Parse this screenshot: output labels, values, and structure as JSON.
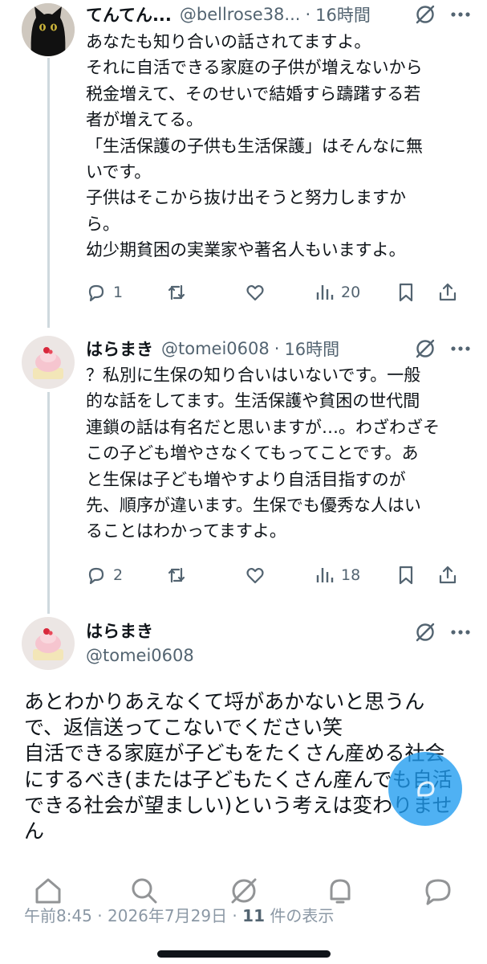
{
  "tweets": [
    {
      "display_name": "てんてん...",
      "handle": "@bellrose38...",
      "separator": "·",
      "time": "16時間",
      "text_lines": [
        "あなたも知り合いの話されてますよ。",
        "それに自活できる家庭の子供が増えないから",
        "税金増えて、そのせいで結婚すら躊躇する若",
        "者が増えてる。",
        "「生活保護の子供も生活保護」はそんなに無",
        "いです。",
        "子供はそこから抜け出そうと努力しますか",
        "ら。",
        "幼少期貧困の実業家や著名人もいますよ。"
      ],
      "replies": "1",
      "views": "20",
      "avatar": "black-cat"
    },
    {
      "display_name": "はらまき",
      "handle": "@tomei0608",
      "separator": "·",
      "time": "16時間",
      "text_lines": [
        "？私別に生保の知り合いはいないです。一般",
        "的な話をしてます。生活保護や貧困の世代間",
        "連鎖の話は有名だと思いますが…。わざわざそ",
        "この子ども増やさなくてもってことです。あ",
        "と生保は子ども増やすより自活目指すのが",
        "先、順序が違います。生保でも優秀な人はい",
        "ることはわかってますよ。"
      ],
      "replies": "2",
      "views": "18",
      "avatar": "cake"
    }
  ],
  "main_tweet": {
    "display_name": "はらまき",
    "handle": "@tomei0608",
    "text_lines": [
      "あとわかりあえなくて埒があかないと思うん",
      "で、返信送ってこないでください笑",
      "自活できる家庭が子どもをたくさん産める社会",
      "にするべき(または子どもたくさん産んでも自活",
      "できる社会が望ましい)という考えは変わりませ",
      "ん"
    ]
  },
  "meta": {
    "time": "午前8:45",
    "sep1": " · ",
    "date": "2026年7月29日",
    "sep2": " · ",
    "views_count": "11",
    "views_label": " 件の表示"
  },
  "colors": {
    "text": "#0f1419",
    "secondary": "#536471",
    "thread_line": "#cfd9de",
    "accent": "#1d9bf0"
  },
  "icons": {
    "action_bar": [
      "reply-icon",
      "retweet-icon",
      "like-icon",
      "views-icon",
      "bookmark-icon",
      "share-icon"
    ],
    "header": [
      "grok-icon",
      "more-icon"
    ],
    "nav": [
      "home-icon",
      "search-icon",
      "grok-icon",
      "notifications-icon",
      "messages-icon"
    ]
  }
}
